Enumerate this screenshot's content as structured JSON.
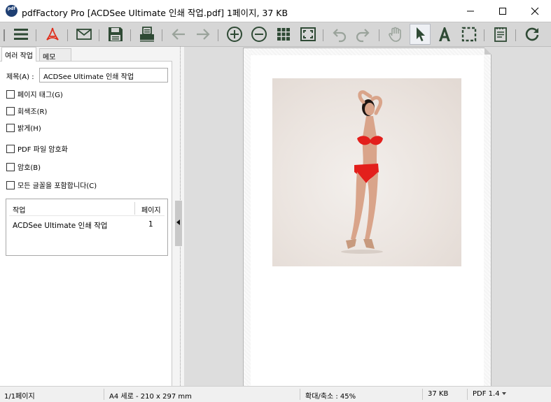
{
  "window": {
    "title": "pdfFactory Pro [ACDSee Ultimate 인쇄 작업.pdf] 1페이지, 37 KB",
    "icon_name": "pdffactory-app-icon",
    "icon_text": "pdf"
  },
  "toolbar": {
    "buttons": [
      {
        "name": "menu-icon"
      },
      {
        "name": "acrobat-icon"
      },
      {
        "name": "envelope-icon"
      },
      {
        "name": "save-icon"
      },
      {
        "name": "printer-icon"
      },
      {
        "name": "back-arrow-icon"
      },
      {
        "name": "forward-arrow-icon"
      },
      {
        "name": "zoom-in-icon"
      },
      {
        "name": "zoom-out-icon"
      },
      {
        "name": "grid-icon"
      },
      {
        "name": "fit-page-icon"
      },
      {
        "name": "undo-icon"
      },
      {
        "name": "redo-icon"
      },
      {
        "name": "hand-icon"
      },
      {
        "name": "pointer-icon",
        "active": true
      },
      {
        "name": "text-tool-icon"
      },
      {
        "name": "select-rect-icon"
      },
      {
        "name": "notes-icon"
      },
      {
        "name": "refresh-icon"
      }
    ],
    "icon_color": "#2f4a35",
    "disabled_color": "#9aa39b",
    "acrobat_color": "#e0301e"
  },
  "left_panel": {
    "tabs": [
      "여러 작업",
      "메모"
    ],
    "title_label": "제목(A) :",
    "title_value": "ACDSee Ultimate 인쇄 작업",
    "checkboxes": [
      "페이지 태그(G)",
      "회색조(R)",
      "밝게(H)",
      "PDF 파일 암호화",
      "암호(B)",
      "모든 글꼴을 포함합니다(C)"
    ],
    "jobs": {
      "col_job": "작업",
      "col_pages": "페이지",
      "rows": [
        {
          "job": "ACDSee Ultimate 인쇄 작업",
          "pages": "1"
        }
      ]
    }
  },
  "status_bar": {
    "page": "1/1페이지",
    "paper": "A4 세로 - 210 x 297 mm",
    "zoom": "확대/축소 :  45%",
    "size": "37 KB",
    "pdf_version": "PDF 1.4"
  }
}
